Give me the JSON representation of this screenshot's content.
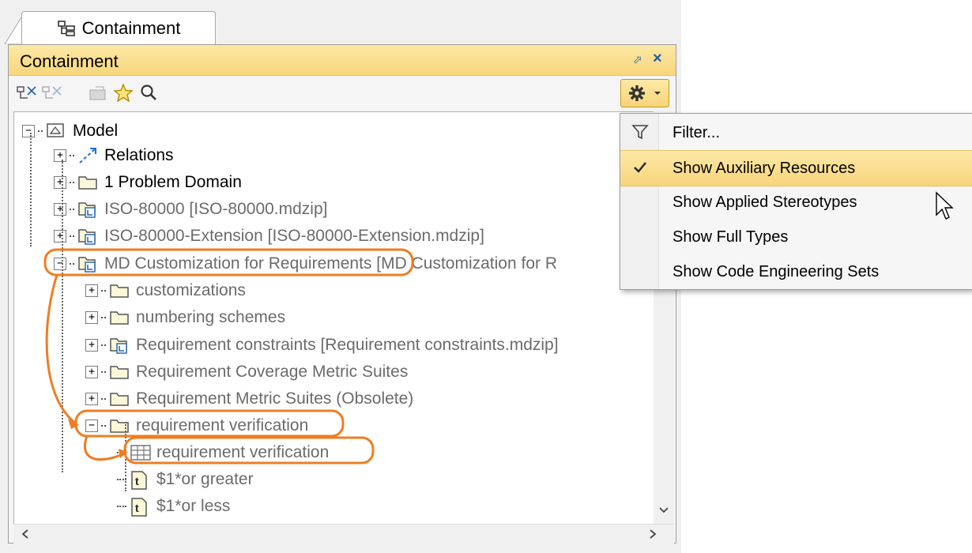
{
  "tab": {
    "label": "Containment"
  },
  "panel": {
    "title": "Containment"
  },
  "tree": [
    {
      "label": "Model",
      "style": "dark",
      "icon": "model-icon",
      "level": 0,
      "expanded": true
    },
    {
      "label": "Relations",
      "style": "dark",
      "icon": "relations-icon",
      "level": 1,
      "expanded": false
    },
    {
      "label": "1 Problem Domain",
      "style": "dark",
      "icon": "folder-icon",
      "level": 1,
      "expanded": false
    },
    {
      "label": "ISO-80000 [ISO-80000.mdzip]",
      "style": "gray",
      "icon": "shared-package-icon",
      "level": 1,
      "expanded": false
    },
    {
      "label": "ISO-80000-Extension [ISO-80000-Extension.mdzip]",
      "style": "gray",
      "icon": "shared-package-icon",
      "level": 1,
      "expanded": false
    },
    {
      "label": "MD Customization for Requirements [MD Customization for R",
      "style": "gray",
      "icon": "shared-package-icon",
      "level": 1,
      "expanded": true
    },
    {
      "label": "customizations",
      "style": "gray",
      "icon": "folder-icon",
      "level": 2,
      "expanded": false
    },
    {
      "label": "numbering schemes",
      "style": "gray",
      "icon": "folder-icon",
      "level": 2,
      "expanded": false
    },
    {
      "label": "Requirement constraints [Requirement constraints.mdzip]",
      "style": "gray",
      "icon": "shared-package-icon",
      "level": 2,
      "expanded": false
    },
    {
      "label": "Requirement Coverage Metric Suites",
      "style": "gray",
      "icon": "folder-icon",
      "level": 2,
      "expanded": false
    },
    {
      "label": "Requirement Metric Suites (Obsolete)",
      "style": "gray",
      "icon": "folder-icon",
      "level": 2,
      "expanded": false
    },
    {
      "label": "requirement verification",
      "style": "gray",
      "icon": "folder-icon",
      "level": 2,
      "expanded": true
    },
    {
      "label": "requirement verification",
      "style": "gray",
      "icon": "table-icon",
      "level": 3,
      "leaf": true
    },
    {
      "label": "$1*or greater",
      "style": "gray",
      "icon": "text-file-icon",
      "level": 3,
      "leaf": true
    },
    {
      "label": "$1*or less",
      "style": "gray",
      "icon": "text-file-icon",
      "level": 3,
      "leaf": true
    }
  ],
  "menu": {
    "items": [
      {
        "label": "Filter...",
        "icon": "filter-icon",
        "checked": false,
        "selected": false
      },
      {
        "label": "Show Auxiliary Resources",
        "icon": "",
        "checked": true,
        "selected": true
      },
      {
        "label": "Show Applied Stereotypes",
        "icon": "",
        "checked": false,
        "selected": false
      },
      {
        "label": "Show Full Types",
        "icon": "",
        "checked": false,
        "selected": false
      },
      {
        "label": "Show Code Engineering Sets",
        "icon": "",
        "checked": false,
        "selected": false
      }
    ]
  },
  "colors": {
    "header": "#f8d67c",
    "highlight": "#ef7d22",
    "selection": "#fde9a6"
  }
}
